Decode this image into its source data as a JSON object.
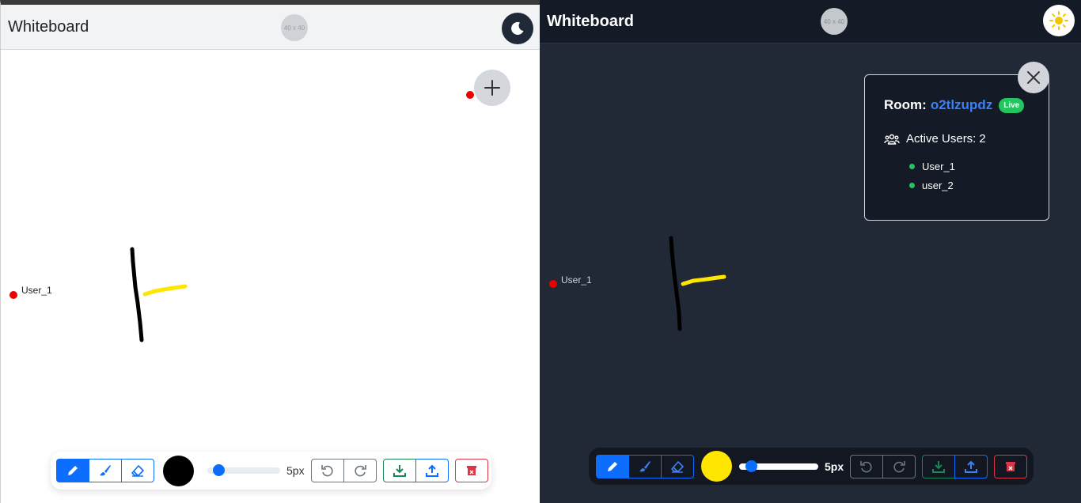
{
  "light": {
    "title": "Whiteboard",
    "avatar_text": "40 x 40",
    "cursor_user": "User_1",
    "brush_color": "#000000",
    "brush_size": 0.1,
    "brush_size_label": "5px"
  },
  "dark": {
    "title": "Whiteboard",
    "avatar_text": "40 x 40",
    "cursor_user": "User_1",
    "room": {
      "label": "Room:",
      "id": "o2tlzupdz",
      "status": "Live",
      "users_label": "Active Users:",
      "users_count": "2",
      "users": [
        "User_1",
        "user_2"
      ]
    },
    "brush_color": "#ffe600",
    "brush_size": 0.1,
    "brush_size_label": "5px"
  },
  "colors": {
    "primary": "#0d6efd",
    "success": "#198754",
    "danger": "#dc3545",
    "live": "#22c55e",
    "room_id": "#3b82f6",
    "stroke_black": "#000000",
    "stroke_yellow": "#ffe600",
    "cursor_red": "#ee0000"
  },
  "icons": {
    "theme_light_pane": "moon-icon",
    "theme_dark_pane": "sun-icon",
    "tools": [
      "pencil-icon",
      "brush-icon",
      "eraser-icon"
    ],
    "history": [
      "undo-icon",
      "redo-icon"
    ],
    "io": [
      "download-icon",
      "upload-icon"
    ],
    "danger": "trash-icon",
    "panel": [
      "users-icon",
      "close-icon",
      "plus-icon"
    ]
  }
}
